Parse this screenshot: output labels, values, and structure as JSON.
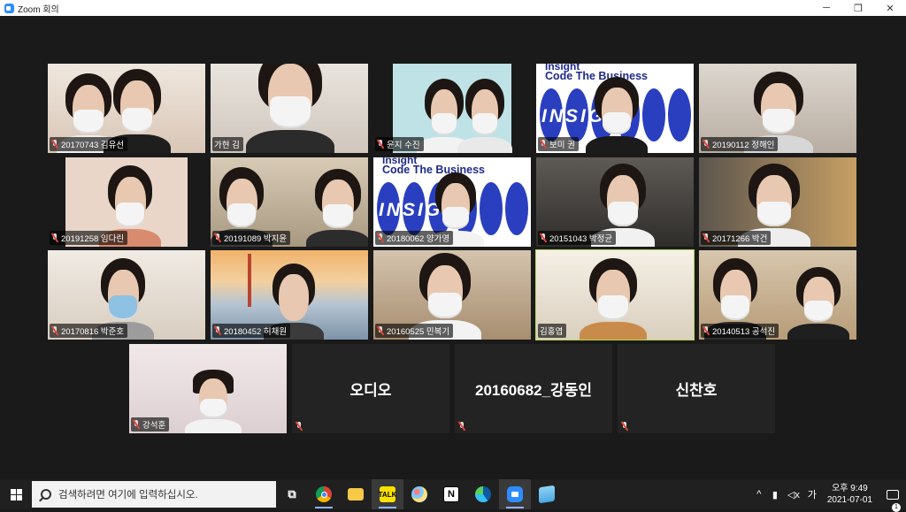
{
  "window": {
    "title": "Zoom 회의",
    "minimize": "─",
    "maximize": "❐",
    "close": "✕"
  },
  "banner": {
    "top": "Insight",
    "headline": "Code The Business",
    "word": "INSIGHT"
  },
  "participants": [
    {
      "name": "20170743 김유선"
    },
    {
      "name": "가현 김"
    },
    {
      "name": "윤지 수진"
    },
    {
      "name": "보미 권"
    },
    {
      "name": "20190112 정해인"
    },
    {
      "name": "20191258 임다린"
    },
    {
      "name": "20191089 박지윤"
    },
    {
      "name": "20180062 양가영"
    },
    {
      "name": "20151043 박정균"
    },
    {
      "name": "20171266 박건"
    },
    {
      "name": "20170816 박준호"
    },
    {
      "name": "20180452 허채원"
    },
    {
      "name": "20160525 민복기"
    },
    {
      "name": "김홍엽"
    },
    {
      "name": "20140513 공석진"
    },
    {
      "name": "강석훈"
    }
  ],
  "audio_tiles": [
    {
      "label": "오디오"
    },
    {
      "label": "20160682_강동인"
    },
    {
      "label": "신찬호"
    }
  ],
  "taskbar": {
    "search_placeholder": "검색하려면 여기에 입력하십시오.",
    "apps": [
      {
        "icon": "task-view-icon",
        "label": "⧉"
      },
      {
        "icon": "chrome-icon",
        "label": ""
      },
      {
        "icon": "file-explorer-icon",
        "label": ""
      },
      {
        "icon": "kakaotalk-icon",
        "label": "TALK"
      },
      {
        "icon": "paint-icon",
        "label": ""
      },
      {
        "icon": "notion-icon",
        "label": "N"
      },
      {
        "icon": "edge-icon",
        "label": ""
      },
      {
        "icon": "zoom-icon",
        "label": ""
      },
      {
        "icon": "notepad-icon",
        "label": ""
      }
    ],
    "tray": {
      "chevron": "^",
      "battery": "▮",
      "volume": "◁x",
      "ime": "가"
    },
    "time": "오후 9:49",
    "date": "2021-07-01",
    "notification_count": "1"
  },
  "colors": {
    "active_speaker": "#b9d84e",
    "zoom_blue": "#2d8cff",
    "mute_red": "#e2463b"
  }
}
